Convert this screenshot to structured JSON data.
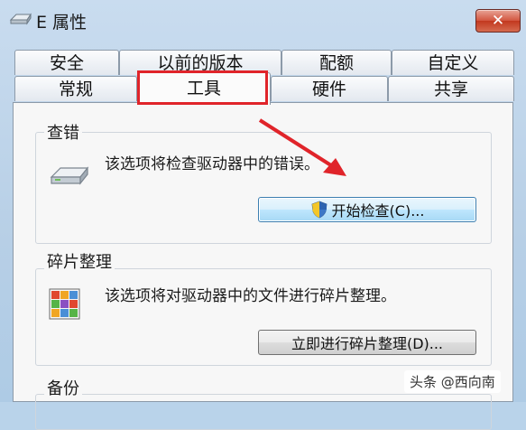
{
  "window": {
    "title": "E 属性",
    "close_label": "✕"
  },
  "tabs": {
    "row1": [
      "安全",
      "以前的版本",
      "配额",
      "自定义"
    ],
    "row2": [
      "常规",
      "工具",
      "硬件",
      "共享"
    ],
    "active": "工具"
  },
  "error_check": {
    "title": "查错",
    "description": "该选项将检查驱动器中的错误。",
    "button_label": "开始检查(C)..."
  },
  "defrag": {
    "title": "碎片整理",
    "description": "该选项将对驱动器中的文件进行碎片整理。",
    "button_label": "立即进行碎片整理(D)..."
  },
  "backup": {
    "title": "备份"
  },
  "watermark": "头条 @西向南",
  "colors": {
    "annotation_red": "#e0242a",
    "close_red": "#c2381f"
  }
}
